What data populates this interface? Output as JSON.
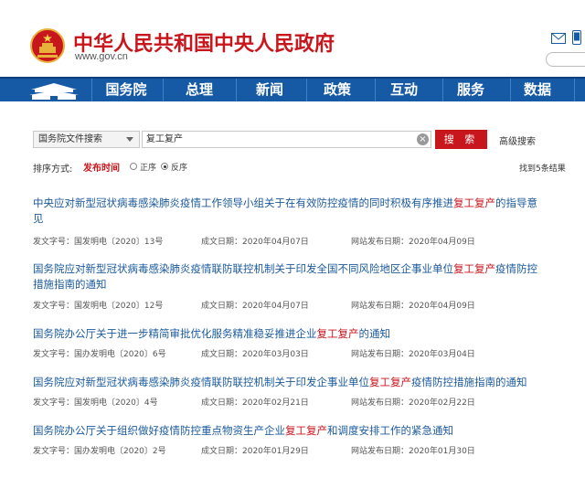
{
  "header": {
    "title": "中华人民共和国中央人民政府",
    "url": "www.gov.cn"
  },
  "nav": {
    "items": [
      "国务院",
      "总理",
      "新闻",
      "政策",
      "互动",
      "服务",
      "数据"
    ]
  },
  "search": {
    "scope": "国务院文件搜索",
    "query": "复工复产",
    "button_label": "搜 索",
    "advanced_label": "高级搜索"
  },
  "sort": {
    "label": "排序方式:",
    "field": "发布时间",
    "options": [
      "正序",
      "反序"
    ],
    "selected": "反序",
    "result_count": "找到5条结果"
  },
  "results": [
    {
      "title_parts": [
        "中央应对新型冠状病毒感染肺炎疫情工作领导小组关于在有效防控疫情的同时积极有序推进",
        "复工复产",
        "的指导意见"
      ],
      "doc_no": "发文字号：国发明电〔2020〕13号",
      "created": "成文日期：2020年04月07日",
      "published": "网站发布日期：2020年04月09日"
    },
    {
      "title_parts": [
        "国务院应对新型冠状病毒感染肺炎疫情联防联控机制关于印发全国不同风险地区企事业单位",
        "复工复产",
        "疫情防控措施指南的通知"
      ],
      "doc_no": "发文字号：国发明电〔2020〕12号",
      "created": "成文日期：2020年04月07日",
      "published": "网站发布日期：2020年04月09日"
    },
    {
      "title_parts": [
        "国务院办公厅关于进一步精简审批优化服务精准稳妥推进企业",
        "复工复产",
        "的通知"
      ],
      "doc_no": "发文字号：国办发明电〔2020〕6号",
      "created": "成文日期：2020年03月03日",
      "published": "网站发布日期：2020年03月04日"
    },
    {
      "title_parts": [
        "国务院应对新型冠状病毒感染肺炎疫情联防联控机制关于印发企事业单位",
        "复工复产",
        "疫情防控措施指南的通知"
      ],
      "doc_no": "发文字号：国发明电〔2020〕4号",
      "created": "成文日期：2020年02月21日",
      "published": "网站发布日期：2020年02月22日"
    },
    {
      "title_parts": [
        "国务院办公厅关于组织做好疫情防控重点物资生产企业",
        "复工复产",
        "和调度安排工作的紧急通知"
      ],
      "doc_no": "发文字号：国办发明电〔2020〕2号",
      "created": "成文日期：2020年01月29日",
      "published": "网站发布日期：2020年01月30日"
    }
  ],
  "colors": {
    "brand_red": "#c8161d",
    "nav_blue": "#1659a5",
    "link_blue": "#1a5a9e"
  },
  "icons": [
    "national-emblem-icon",
    "mail-icon",
    "mobile-icon",
    "tiananmen-icon",
    "clear-icon",
    "dropdown-arrow-icon"
  ]
}
